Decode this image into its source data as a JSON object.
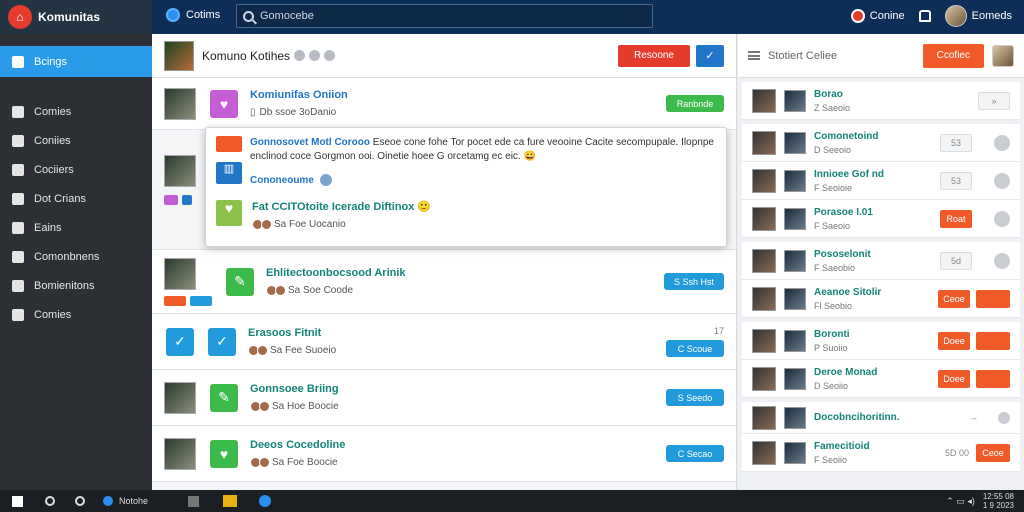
{
  "app": {
    "title": "Komunitas"
  },
  "topbar": {
    "tab_label": "Cotims",
    "search_placeholder": "Gomocebe",
    "notif_label": "Conine",
    "user_name": "Eomeds"
  },
  "sidebar": {
    "items": [
      {
        "label": "Bcings",
        "icon": "home-icon",
        "active": true
      },
      {
        "label": "Comies",
        "icon": "list-icon"
      },
      {
        "label": "Coniies",
        "icon": "doc-icon"
      },
      {
        "label": "Cociiers",
        "icon": "chart-icon"
      },
      {
        "label": "Dot Crians",
        "icon": "doc-icon"
      },
      {
        "label": "Eains",
        "icon": "pin-icon"
      },
      {
        "label": "Comonbnens",
        "icon": "settings-icon"
      },
      {
        "label": "Bomienitons",
        "icon": "globe-icon"
      },
      {
        "label": "Comies",
        "icon": "wrench-icon"
      }
    ]
  },
  "main": {
    "header_title": "Komuno Kotihes",
    "header_button": "Resoone",
    "rows": [
      {
        "title": "Komiunifas Oniion",
        "sub": "Db ssoe 3oDanio",
        "button": "Ranbnde",
        "button_color": "green"
      },
      {
        "title": "Ehlitectoonbocsood Arinik",
        "sub": "Sa Soe Coode",
        "button": "S Ssh Hst",
        "button_color": "blue"
      },
      {
        "title": "Erasoos Fitnit",
        "sub": "Sa Fee Suoeio",
        "button": "C Scoue",
        "button_color": "blue",
        "count": "17"
      },
      {
        "title": "Gonnsoee Briing",
        "sub": "Sa Hoe Boocie",
        "button": "S Seedo",
        "button_color": "blue"
      },
      {
        "title": "Deeos Cocedoline",
        "sub": "Sa Foe Boocie",
        "button": "C Secao",
        "button_color": "blue"
      }
    ],
    "popup": {
      "title": "Gonnosovet Motl Corooo",
      "text1": "Eseoe cone fohe Tor pocet ede ca fure veooine Cacite secompupale.",
      "text2": "Ilopnpe enclinod coce Gorgmon ooi. Oinetie hoee G orcetamg ec eic.",
      "link": "Cononeoume",
      "second_title": "Fat CCITOtoite Icerade Diftinox",
      "second_sub": "Sa Foe Uocanio"
    }
  },
  "right": {
    "header_title": "Stotiert Celiee",
    "header_button": "Ccofiec",
    "rows": [
      {
        "title": "Borao",
        "sub": "Z Saeoio",
        "action": "grey",
        "action_label": "",
        "button": ""
      },
      {
        "title": "Comonetoind",
        "sub": "D Seeoio",
        "action": "grey",
        "action_label": "53",
        "button": ""
      },
      {
        "title": "Innioee Gof nd",
        "sub": "F Seoioie",
        "action": "grey",
        "action_label": "53",
        "button": ""
      },
      {
        "title": "Porasoe I.01",
        "sub": "F Saeoio",
        "action": "orange",
        "action_label": "Roat",
        "button": ""
      },
      {
        "title": "Pososelonit",
        "sub": "F Saeobio",
        "action": "grey",
        "action_label": "5d",
        "button": ""
      },
      {
        "title": "Aeanoe Sitolir",
        "sub": "Fl Seobio",
        "action": "orange",
        "action_label": "Ceoe",
        "button": "orange"
      },
      {
        "title": "Boronti",
        "sub": "P Suoiio",
        "action": "orange",
        "action_label": "Doee",
        "button": "orange"
      },
      {
        "title": "Deroe Monad",
        "sub": "D Seoiio",
        "action": "orange",
        "action_label": "Doee",
        "button": "orange"
      },
      {
        "title": "Docobncihoritinn.",
        "sub": "",
        "action": "grey",
        "action_label": "",
        "button": ""
      },
      {
        "title": "Famecitioid",
        "sub": "F Seoiio",
        "action": "grey",
        "action_label": "5D 00",
        "button": "orange",
        "button_label": "Ceoe"
      }
    ]
  },
  "taskbar": {
    "app_label": "Notohe",
    "time": "12:55 08",
    "date": "1 9 2023"
  }
}
